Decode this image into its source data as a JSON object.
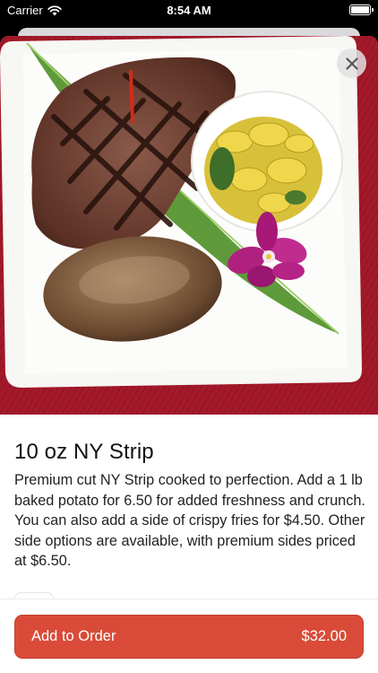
{
  "status_bar": {
    "carrier": "Carrier",
    "time": "8:54 AM"
  },
  "item": {
    "name": "10 oz NY Strip",
    "description": "Premium cut NY Strip cooked to perfection. Add a 1 lb baked potato for 6.50 for added freshness and crunch. You can also add a side of crispy fries for $4.50. Other side options are available, with premium sides priced at $6.50.",
    "photo_icon": "food-photo"
  },
  "footer": {
    "add_label": "Add to Order",
    "price": "$32.00"
  },
  "colors": {
    "accent": "#d94b38",
    "tablecloth": "#a3192a"
  }
}
